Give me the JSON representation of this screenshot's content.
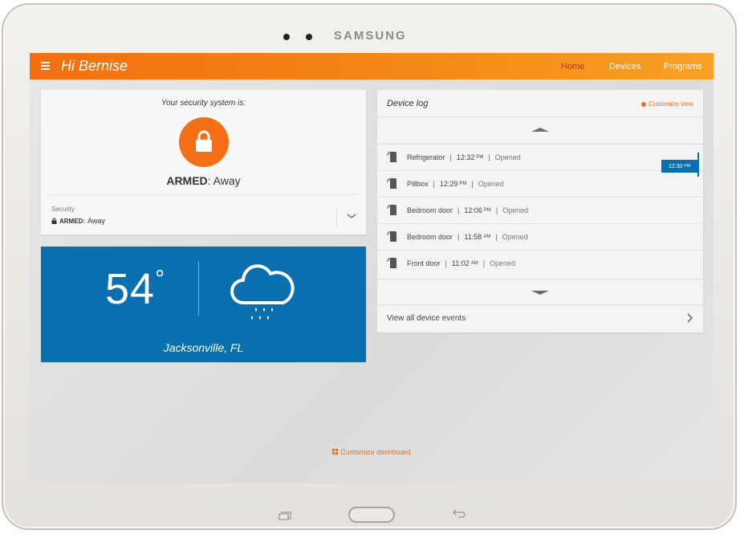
{
  "device": {
    "brand": "SAMSUNG"
  },
  "header": {
    "greeting": "Hi Bernise",
    "nav": [
      {
        "label": "Home",
        "active": true
      },
      {
        "label": "Devices",
        "active": false
      },
      {
        "label": "Programs",
        "active": false
      }
    ]
  },
  "security": {
    "status_label": "Your security system is:",
    "state": "ARMED",
    "mode": ": Away",
    "section_label": "Security",
    "small_state": "ARMED:",
    "small_mode": "Away",
    "icon": "lock-icon"
  },
  "weather": {
    "temperature": "54",
    "degree": "°",
    "city": "Jacksonville, FL",
    "icon": "rain-cloud-icon"
  },
  "device_log": {
    "title": "Device log",
    "customize_label": "Customize view",
    "entries": [
      {
        "device": "Refrigerator",
        "time": "12:32",
        "ampm": "PM",
        "event": "Opened"
      },
      {
        "device": "Pillbox",
        "time": "12:29",
        "ampm": "PM",
        "event": "Opened"
      },
      {
        "device": "Bedroom door",
        "time": "12:06",
        "ampm": "PM",
        "event": "Opened"
      },
      {
        "device": "Bedroom door",
        "time": "11:58",
        "ampm": "AM",
        "event": "Opened"
      },
      {
        "device": "Front door",
        "time": "11:02",
        "ampm": "AM",
        "event": "Opened"
      }
    ],
    "view_all_label": "View all device events",
    "timeline_time": "12:30",
    "timeline_ampm": "PM"
  },
  "footer": {
    "customize_dashboard": "Customize dashboard"
  },
  "colors": {
    "accent_orange": "#f36f15",
    "weather_blue": "#0a6faf",
    "active_nav": "#b0391a"
  }
}
